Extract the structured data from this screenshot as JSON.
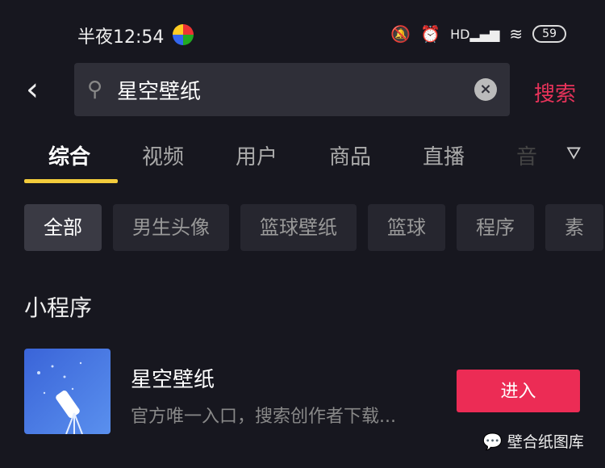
{
  "status_bar": {
    "time": "半夜12:54",
    "battery": "59",
    "icons": [
      "mute-bell-icon",
      "alarm-icon",
      "hd-signal-icon",
      "wifi-icon",
      "battery-icon"
    ]
  },
  "search": {
    "value": "星空壁纸",
    "submit_label": "搜索"
  },
  "tabs": [
    {
      "label": "综合",
      "active": true
    },
    {
      "label": "视频"
    },
    {
      "label": "用户"
    },
    {
      "label": "商品"
    },
    {
      "label": "直播"
    },
    {
      "label": "音"
    }
  ],
  "chips": [
    {
      "label": "全部",
      "active": true
    },
    {
      "label": "男生头像"
    },
    {
      "label": "篮球壁纸"
    },
    {
      "label": "篮球"
    },
    {
      "label": "程序"
    },
    {
      "label": "素"
    }
  ],
  "section_title": "小程序",
  "mini_program": {
    "name": "星空壁纸",
    "description": "官方唯一入口，搜索创作者下载...",
    "enter_label": "进入"
  },
  "watermark": "壁合纸图库",
  "colors": {
    "accent": "#ec2c55",
    "tab_underline": "#f3cc3c",
    "background": "#17171f"
  }
}
